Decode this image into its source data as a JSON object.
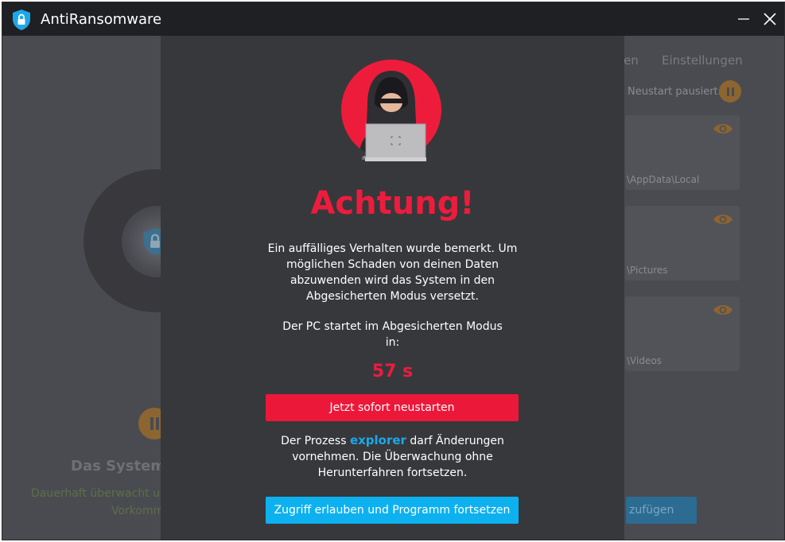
{
  "window": {
    "title": "AntiRansomware"
  },
  "background": {
    "tabs": [
      "en",
      "Einstellungen"
    ],
    "status_text": "Neustart pausiert.",
    "cards": [
      {
        "path": "\\AppData\\Local"
      },
      {
        "path": "\\Pictures"
      },
      {
        "path": "\\Videos"
      }
    ],
    "add_button": "zufügen",
    "heading": "Das System i",
    "subtext_1": "Dauerhaft überwacht u",
    "subtext_2": "Vorkomm"
  },
  "modal": {
    "title": "Achtung!",
    "message": "Ein auffälliges Verhalten wurde bemerkt. Um möglichen Schaden von deinen Daten abzuwenden wird das System in den Abgesicherten Modus versetzt.",
    "countdown_label": "Der PC startet im Abgesicherten Modus in:",
    "countdown": "57 s",
    "restart_button": "Jetzt sofort neustarten",
    "process_prefix": "Der Prozess",
    "process_name": "explorer",
    "process_suffix": "darf Änderungen vornehmen. Die Überwachung ohne Herunterfahren fortsetzen.",
    "allow_button": "Zugriff erlauben und Programm fortsetzen"
  },
  "colors": {
    "accent_red": "#ed1c3c",
    "accent_blue": "#0db1f0",
    "modal_bg": "#37383c"
  },
  "icons": {
    "app": "shield-lock-icon",
    "illustration": "hacker-illustration",
    "eye": "eye-icon",
    "pause": "pause-icon"
  }
}
